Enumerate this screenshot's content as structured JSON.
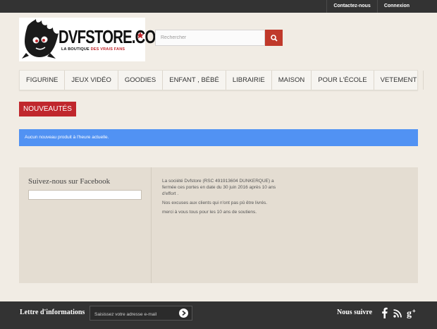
{
  "topbar": {
    "contact": "Contactez-nous",
    "login": "Connexion"
  },
  "logo": {
    "brand": "DVFSTORE.COM",
    "tagline_left": "LA BOUTIQUE ",
    "tagline_right": "DES VRAIS FANS"
  },
  "search": {
    "placeholder": "Rechercher",
    "icon": "search-icon"
  },
  "menu": {
    "items": [
      {
        "label": "Figurine"
      },
      {
        "label": "Jeux vidéo"
      },
      {
        "label": "Goodies"
      },
      {
        "label": "Enfant , bébé"
      },
      {
        "label": "Librairie"
      },
      {
        "label": "Maison"
      },
      {
        "label": "Pour l'école"
      },
      {
        "label": "Vetement"
      }
    ]
  },
  "section": {
    "title": "Nouveautés"
  },
  "alert": {
    "text": "Aucun nouveau produit à l'heure actuelle."
  },
  "facebook": {
    "title": "Suivez-nous sur Facebook"
  },
  "notice": {
    "p1": "La société Dvfstore (RSC 491913604 DUNKERQUE)  a fermée ces portes en date du 30 juin 2016 après 10 ans d'effort .",
    "p2": "Nos excuses aux clients qui n'ont pas pû être livrés.",
    "p3": "merci à vous tous pour les 10 ans de soutiens."
  },
  "newsletter": {
    "title": "Lettre d'informations",
    "placeholder": "Saisissez votre adresse e-mail"
  },
  "social": {
    "title": "Nous suivre",
    "icons": [
      "facebook-icon",
      "rss-icon",
      "google-plus-icon"
    ]
  },
  "colors": {
    "accent": "#c0272d",
    "info": "#5192f3",
    "dark": "#333333",
    "background": "#f1ece4"
  }
}
